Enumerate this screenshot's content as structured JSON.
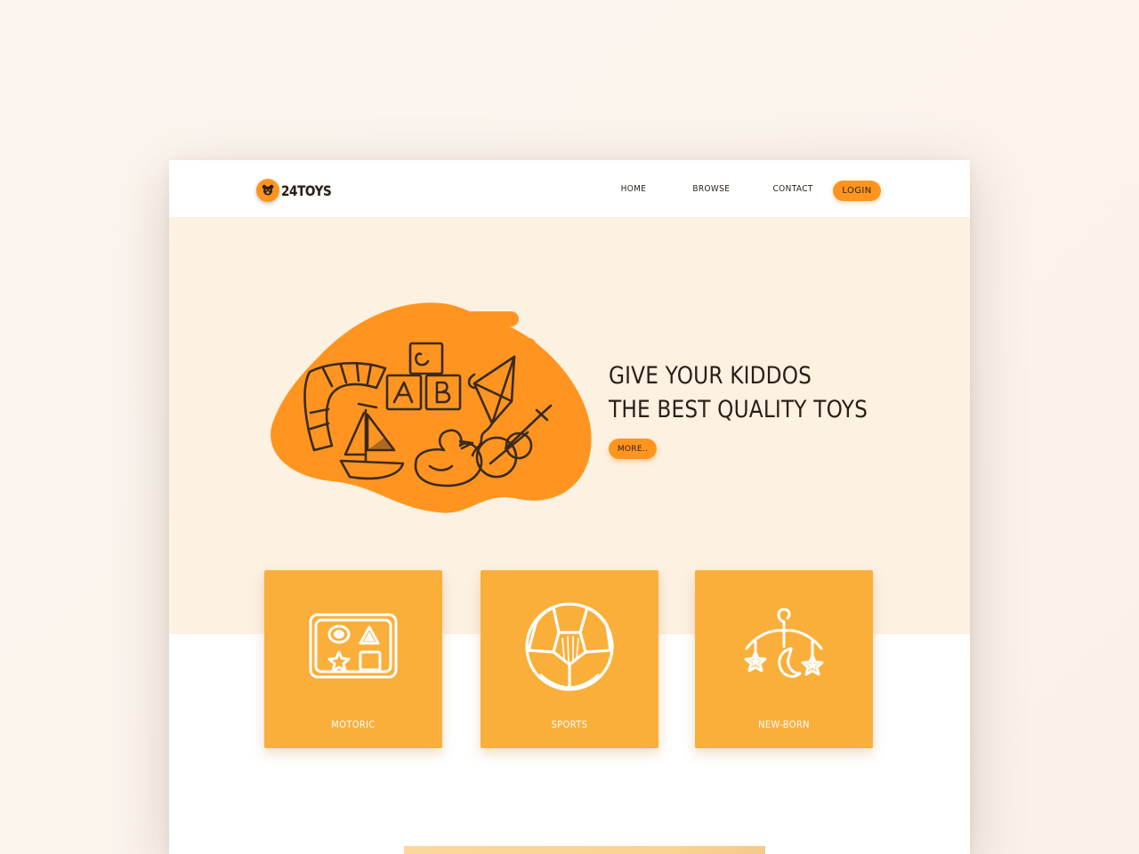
{
  "brand": {
    "name": "24TOYS",
    "logo_icon": "teddy-bear-icon"
  },
  "nav": {
    "items": [
      {
        "label": "HOME"
      },
      {
        "label": "BROWSE"
      },
      {
        "label": "CONTACT"
      }
    ],
    "login_label": "LOGIN"
  },
  "hero": {
    "title_line1": "GIVE YOUR KIDDOS",
    "title_line2": "THE BEST QUALITY TOYS",
    "more_label": "MORE..",
    "illustration_icon": "toys-doodle-icon",
    "block_letters": [
      "C",
      "A",
      "B"
    ]
  },
  "categories": [
    {
      "label": "MOTORIC",
      "icon": "shape-sorter-icon"
    },
    {
      "label": "SPORTS",
      "icon": "soccer-ball-icon"
    },
    {
      "label": "NEW-BORN",
      "icon": "baby-mobile-icon"
    }
  ],
  "colors": {
    "accent": "#ff951f",
    "card": "#faaf3b",
    "hero_bg": "#fdf1e2",
    "text": "#2a1f16"
  }
}
